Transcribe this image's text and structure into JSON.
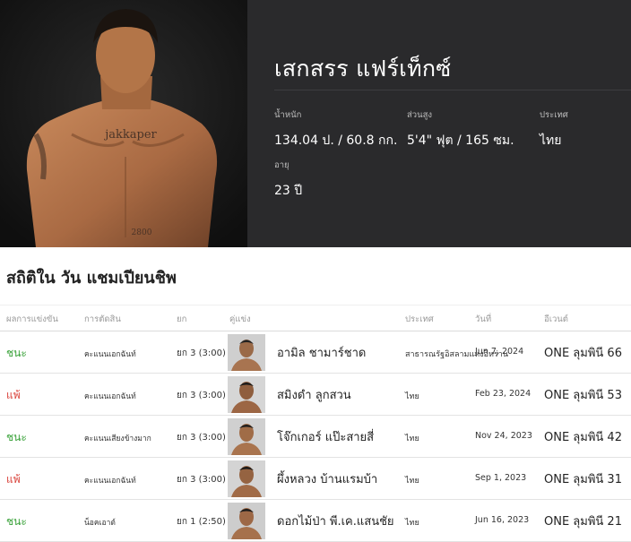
{
  "fighter": {
    "name": "เสกสรร แฟร์เท็กซ์",
    "stats": [
      {
        "label": "น้ำหนัก",
        "value": "134.04 ป. / 60.8 กก."
      },
      {
        "label": "ส่วนสูง",
        "value": "5'4\" ฟุต / 165 ซม."
      },
      {
        "label": "ประเทศ",
        "value": "ไทย"
      },
      {
        "label": "อายุ",
        "value": "23 ปี"
      }
    ],
    "tattoo_chest": "jakkaper",
    "tattoo_belly": "2800"
  },
  "history": {
    "title": "สถิติใน วัน แชมเปียนชิพ",
    "columns": [
      "ผลการแข่งขัน",
      "การตัดสิน",
      "ยก",
      "คู่แข่ง",
      "ประเทศ",
      "วันที่",
      "อีเวนต์"
    ],
    "rows": [
      {
        "result": "ชนะ",
        "outcome": "win",
        "method": "คะแนนเอกฉันท์",
        "round": "ยก 3 (3:00)",
        "opponent": "อามิล ชามาร์ชาด",
        "country": "สาธารณรัฐอิสลามแห่งอิหร่าน",
        "date": "Jun 7, 2024",
        "event": "ONE ลุมพินี 66"
      },
      {
        "result": "แพ้",
        "outcome": "loss",
        "method": "คะแนนเอกฉันท์",
        "round": "ยก 3 (3:00)",
        "opponent": "สมิงดำ ลูกสวน",
        "country": "ไทย",
        "date": "Feb 23, 2024",
        "event": "ONE ลุมพินี 53"
      },
      {
        "result": "ชนะ",
        "outcome": "win",
        "method": "คะแนนเสียงข้างมาก",
        "round": "ยก 3 (3:00)",
        "opponent": "โจ๊กเกอร์ แป๊ะสายสี่",
        "country": "ไทย",
        "date": "Nov 24, 2023",
        "event": "ONE ลุมพินี 42"
      },
      {
        "result": "แพ้",
        "outcome": "loss",
        "method": "คะแนนเอกฉันท์",
        "round": "ยก 3 (3:00)",
        "opponent": "ผึ้งหลวง บ้านแรมบ้า",
        "country": "ไทย",
        "date": "Sep 1, 2023",
        "event": "ONE ลุมพินี 31"
      },
      {
        "result": "ชนะ",
        "outcome": "win",
        "method": "น็อคเอาต์",
        "round": "ยก 1 (2:50)",
        "opponent": "ดอกไม้ป่า พี.เค.แสนชัย",
        "country": "ไทย",
        "date": "Jun 16, 2023",
        "event": "ONE ลุมพินี 21"
      }
    ]
  },
  "colors": {
    "win": "#3aa23a",
    "loss": "#d9423a",
    "hero_bg": "#2a2a2c"
  }
}
